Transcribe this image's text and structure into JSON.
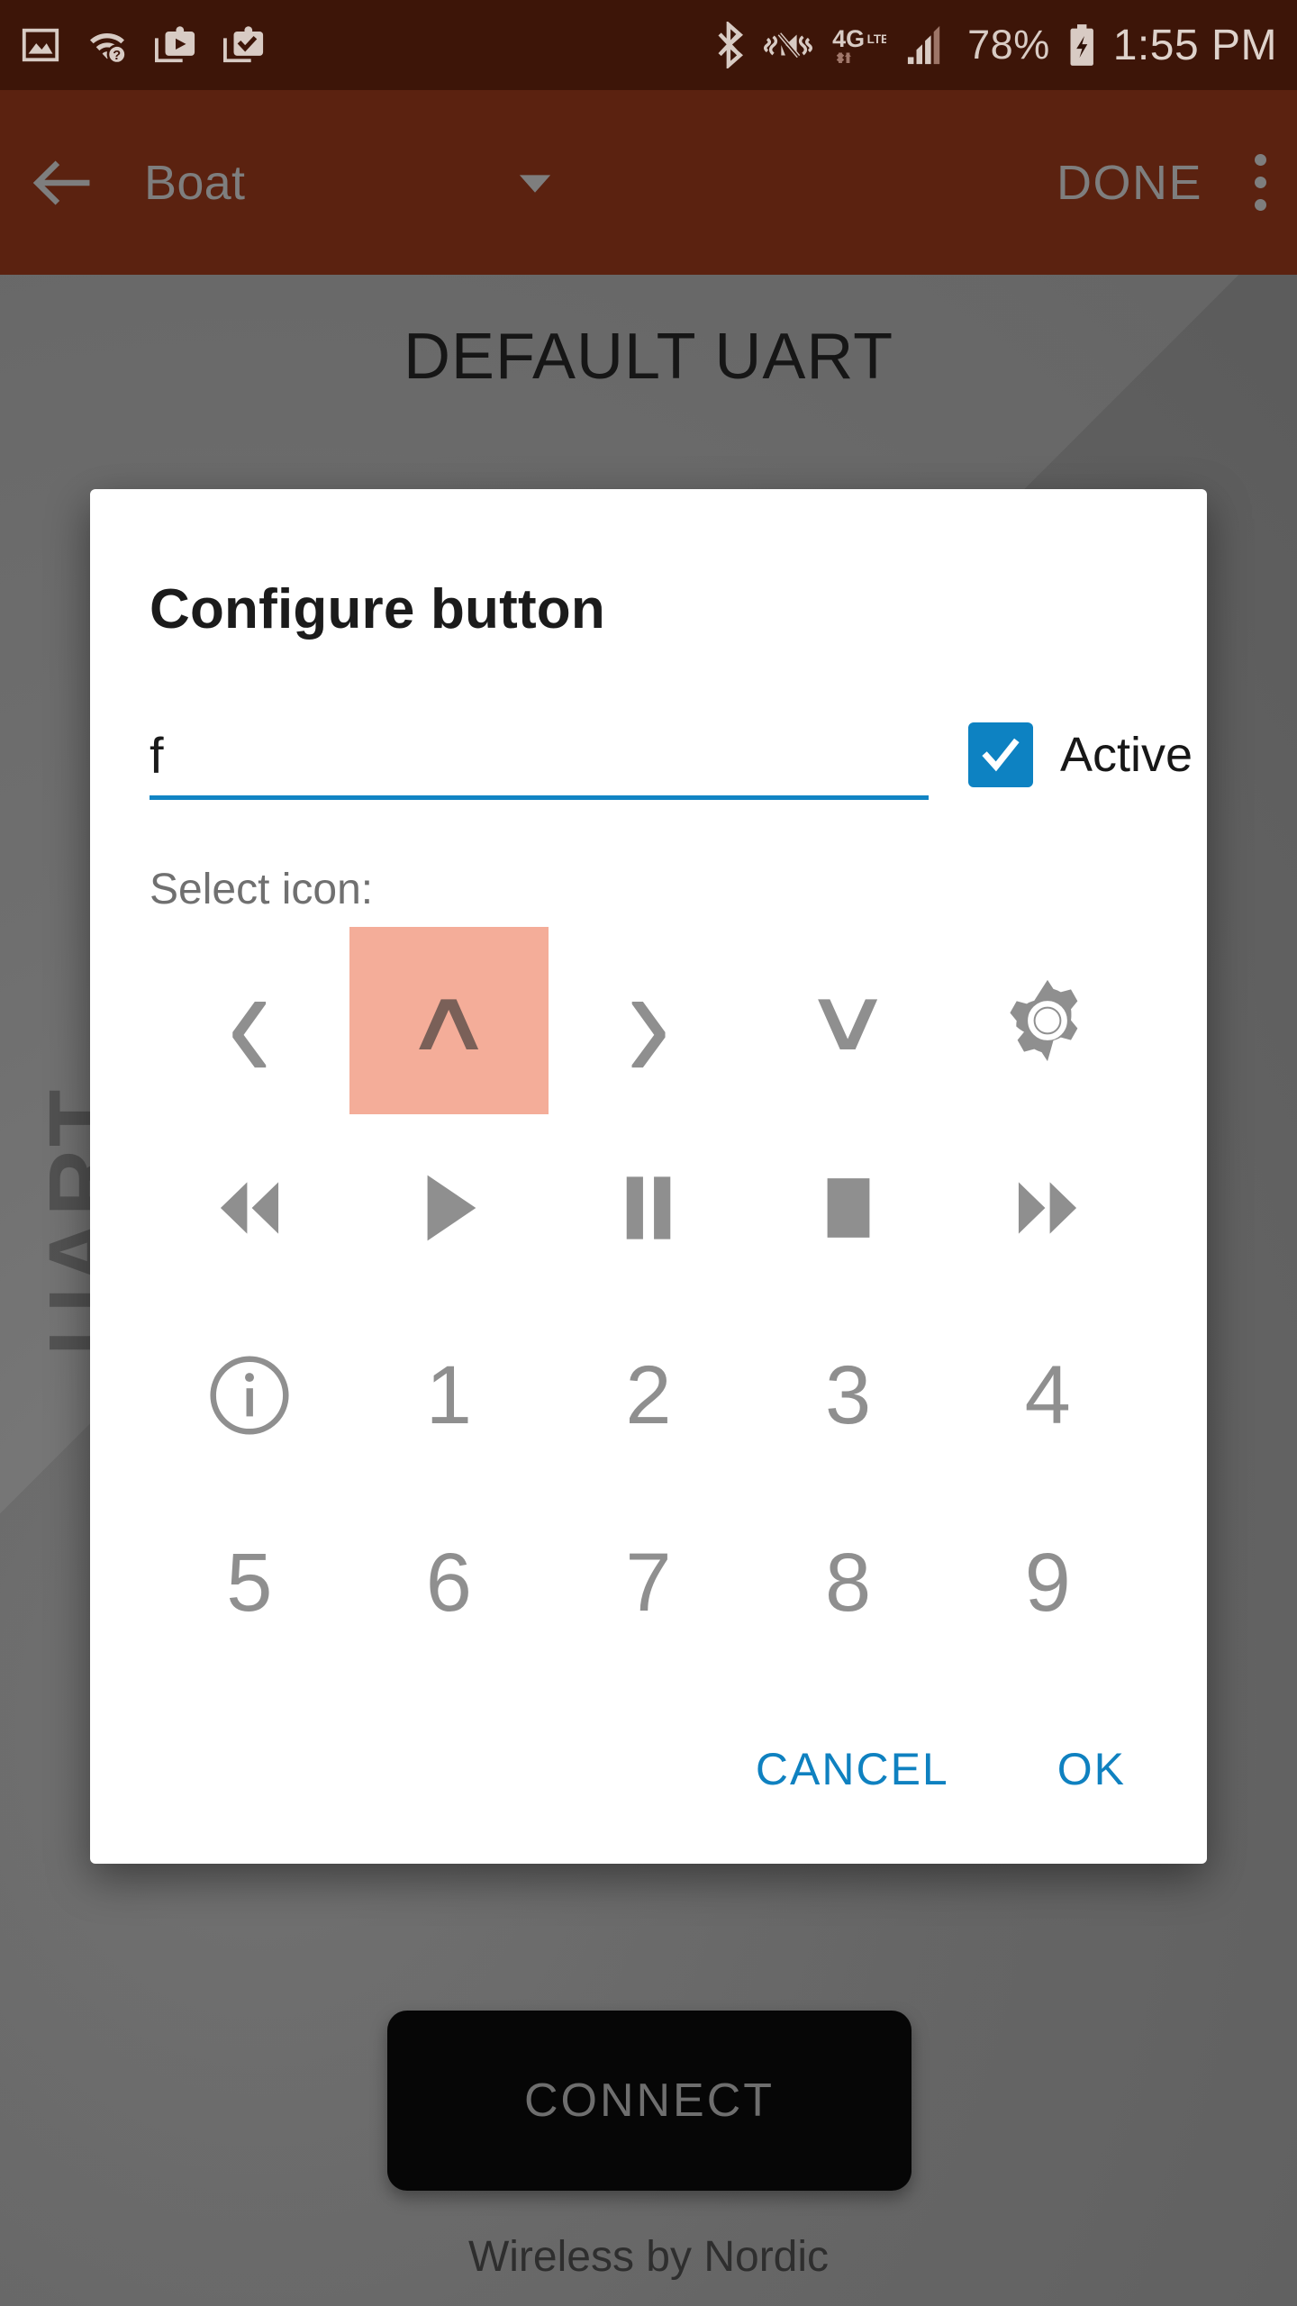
{
  "status_bar": {
    "left_icons": [
      "image-icon",
      "wifi-question-icon",
      "clipboard-play-icon",
      "clipboard-check-icon"
    ],
    "right_icons": [
      "bluetooth-icon",
      "vibrate-off-icon",
      "network-4glte-icon",
      "signal-bars-icon"
    ],
    "battery_percent": "78%",
    "battery_state": "charging",
    "time": "1:55 PM",
    "background_color": "#3d1508",
    "foreground_color": "#d8cbc4"
  },
  "app_bar": {
    "back_icon": "arrow-left-icon",
    "title": "Boat",
    "dropdown_icon": "caret-down-icon",
    "done_label": "DONE",
    "overflow_icon": "kebab-menu-icon",
    "background_color": "#5b2210",
    "foreground_color": "#7e7e7e"
  },
  "background_page": {
    "title": "DEFAULT UART",
    "side_watermark": "UART",
    "connect_label": "CONNECT",
    "footer": "Wireless by Nordic"
  },
  "dialog": {
    "title": "Configure button",
    "input": {
      "value": "f",
      "placeholder": ""
    },
    "checkbox": {
      "label": "Active",
      "checked": true,
      "color": "#0d82c2",
      "icon": "check-icon"
    },
    "select_icon_label": "Select icon:",
    "selected_index": 1,
    "selected_highlight_color": "#f4ad99",
    "icons": [
      {
        "name": "chevron-left-icon",
        "kind": "glyph",
        "glyph": "‹"
      },
      {
        "name": "chevron-up-icon",
        "kind": "glyph",
        "glyph": "∧"
      },
      {
        "name": "chevron-right-icon",
        "kind": "glyph",
        "glyph": "›"
      },
      {
        "name": "chevron-down-icon",
        "kind": "glyph",
        "glyph": "∨"
      },
      {
        "name": "gear-icon",
        "kind": "svg",
        "glyph": ""
      },
      {
        "name": "rewind-icon",
        "kind": "svg",
        "glyph": ""
      },
      {
        "name": "play-icon",
        "kind": "svg",
        "glyph": ""
      },
      {
        "name": "pause-icon",
        "kind": "svg",
        "glyph": ""
      },
      {
        "name": "stop-icon",
        "kind": "svg",
        "glyph": ""
      },
      {
        "name": "fast-forward-icon",
        "kind": "svg",
        "glyph": ""
      },
      {
        "name": "info-icon",
        "kind": "svg",
        "glyph": ""
      },
      {
        "name": "digit-1-icon",
        "kind": "digit",
        "glyph": "1"
      },
      {
        "name": "digit-2-icon",
        "kind": "digit",
        "glyph": "2"
      },
      {
        "name": "digit-3-icon",
        "kind": "digit",
        "glyph": "3"
      },
      {
        "name": "digit-4-icon",
        "kind": "digit",
        "glyph": "4"
      },
      {
        "name": "digit-5-icon",
        "kind": "digit",
        "glyph": "5"
      },
      {
        "name": "digit-6-icon",
        "kind": "digit",
        "glyph": "6"
      },
      {
        "name": "digit-7-icon",
        "kind": "digit",
        "glyph": "7"
      },
      {
        "name": "digit-8-icon",
        "kind": "digit",
        "glyph": "8"
      },
      {
        "name": "digit-9-icon",
        "kind": "digit",
        "glyph": "9"
      }
    ],
    "cancel_label": "CANCEL",
    "ok_label": "OK",
    "action_color": "#0f81c0"
  }
}
